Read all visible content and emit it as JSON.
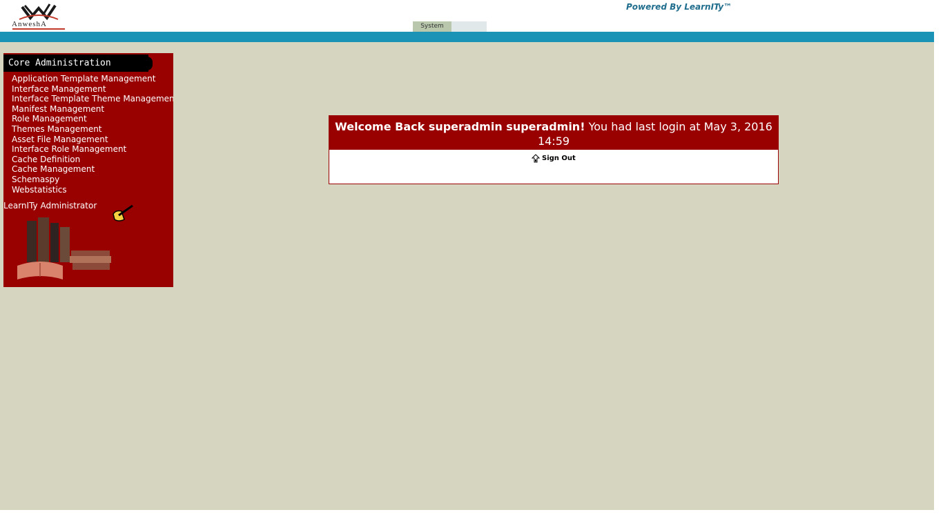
{
  "header": {
    "logo_text": "AnweshA",
    "powered_by": "Powered By LearnITy™"
  },
  "tabs": [
    {
      "label": "System"
    },
    {
      "label": ""
    }
  ],
  "sidebar": {
    "title": "Core Administration",
    "items": [
      {
        "label": "Application Template Management"
      },
      {
        "label": "Interface Management"
      },
      {
        "label": "Interface Template Theme Management"
      },
      {
        "label": "Manifest Management"
      },
      {
        "label": "Role Management"
      },
      {
        "label": "Themes Management"
      },
      {
        "label": "Asset File Management"
      },
      {
        "label": "Interface Role Management"
      },
      {
        "label": "Cache Definition"
      },
      {
        "label": "Cache Management"
      },
      {
        "label": "Schemaspy"
      },
      {
        "label": "Webstatistics"
      }
    ],
    "footer_label": "LearnITy Administrator"
  },
  "welcome": {
    "greeting": "Welcome Back superadmin superadmin!",
    "last_login_text": " You had last login at May 3, 2016 14:59",
    "signout_label": "Sign Out"
  },
  "colors": {
    "accent_bar": "#1a93b6",
    "panel_red": "#990000",
    "content_bg": "#d6d5c0",
    "powered_by": "#1f6d8c"
  }
}
